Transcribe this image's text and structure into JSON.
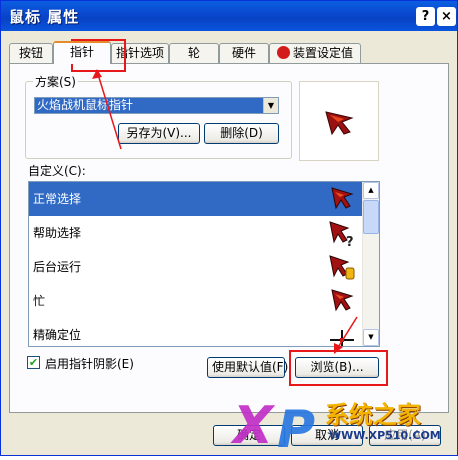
{
  "window": {
    "title": "鼠标 属性",
    "help_btn": "?",
    "close_btn": "×"
  },
  "tabs": [
    {
      "label": "按钮"
    },
    {
      "label": "指针"
    },
    {
      "label": "指针选项"
    },
    {
      "label": "轮"
    },
    {
      "label": "硬件"
    },
    {
      "label": "装置设定值"
    }
  ],
  "scheme": {
    "label": "方案(S)",
    "selected": "火焰战机鼠标指针",
    "save_as": "另存为(V)...",
    "delete": "删除(D)"
  },
  "customize": {
    "label": "自定义(C):",
    "items": [
      {
        "label": "正常选择",
        "cursor": "arrow-cursor-icon"
      },
      {
        "label": "帮助选择",
        "cursor": "help-cursor-icon"
      },
      {
        "label": "后台运行",
        "cursor": "working-cursor-icon"
      },
      {
        "label": "忙",
        "cursor": "busy-cursor-icon"
      },
      {
        "label": "精确定位",
        "cursor": "crosshair-cursor-icon"
      }
    ]
  },
  "shadow_checkbox": {
    "label": "启用指针阴影(E)",
    "checked": true
  },
  "buttons": {
    "use_default": "使用默认值(F)",
    "browse": "浏览(B)..."
  },
  "footer": {
    "ok": "确定",
    "cancel": "取消",
    "apply": "应用(A)"
  },
  "watermark": {
    "brand": "系统之家",
    "url": "WWW.XP510.COM"
  },
  "colors": {
    "highlight": "#316ac5",
    "annotation_red": "#e8171a",
    "titlebar": "#0a55de"
  }
}
